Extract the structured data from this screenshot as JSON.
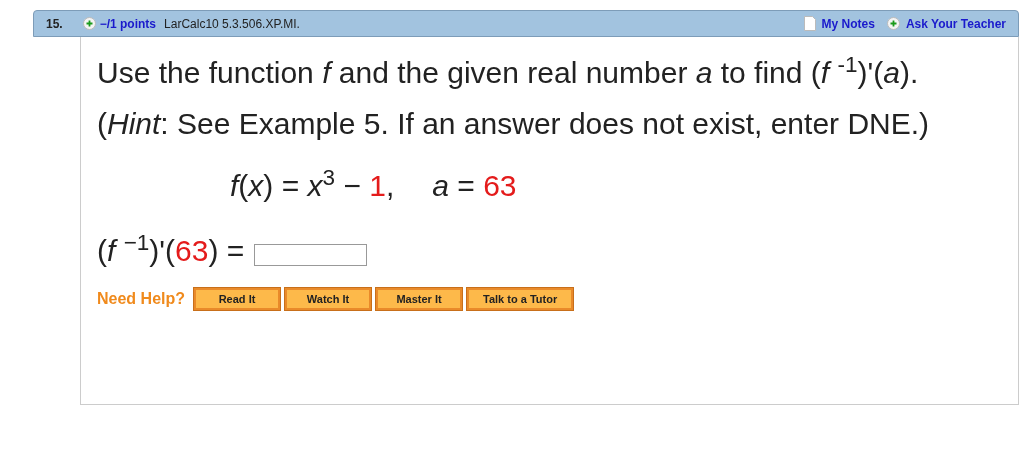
{
  "header": {
    "number": "15.",
    "points": "−/1 points",
    "source": "LarCalc10 5.3.506.XP.MI.",
    "links": [
      {
        "kind": "notes",
        "label": "My Notes"
      },
      {
        "kind": "ask",
        "label": "Ask Your Teacher"
      }
    ]
  },
  "question": "Use the function *f* and the given real number *a* to find (*f* $^{-1}$)'(*a*). (*Hint*: See Example 5. If an answer does not exist, enter DNE.)",
  "equation": [
    {
      "text": "*f*(*x*) = *x*$^{3}$ − ",
      "highlighted": false
    },
    {
      "text": "1",
      "highlighted": true
    },
    {
      "text": ",",
      "highlighted": false
    },
    {
      "text": "*a* = ",
      "highlighted": false
    },
    {
      "text": "63",
      "highlighted": true
    }
  ],
  "answer_prompt": [
    {
      "text": "(*f* $^{−1}$)'(",
      "highlighted": false
    },
    {
      "text": "63",
      "highlighted": true
    },
    {
      "text": ") =",
      "highlighted": false
    }
  ],
  "need_help": {
    "label": "Need Help?",
    "buttons": [
      "Read It",
      "Watch It",
      "Master It",
      "Talk to a Tutor"
    ]
  }
}
